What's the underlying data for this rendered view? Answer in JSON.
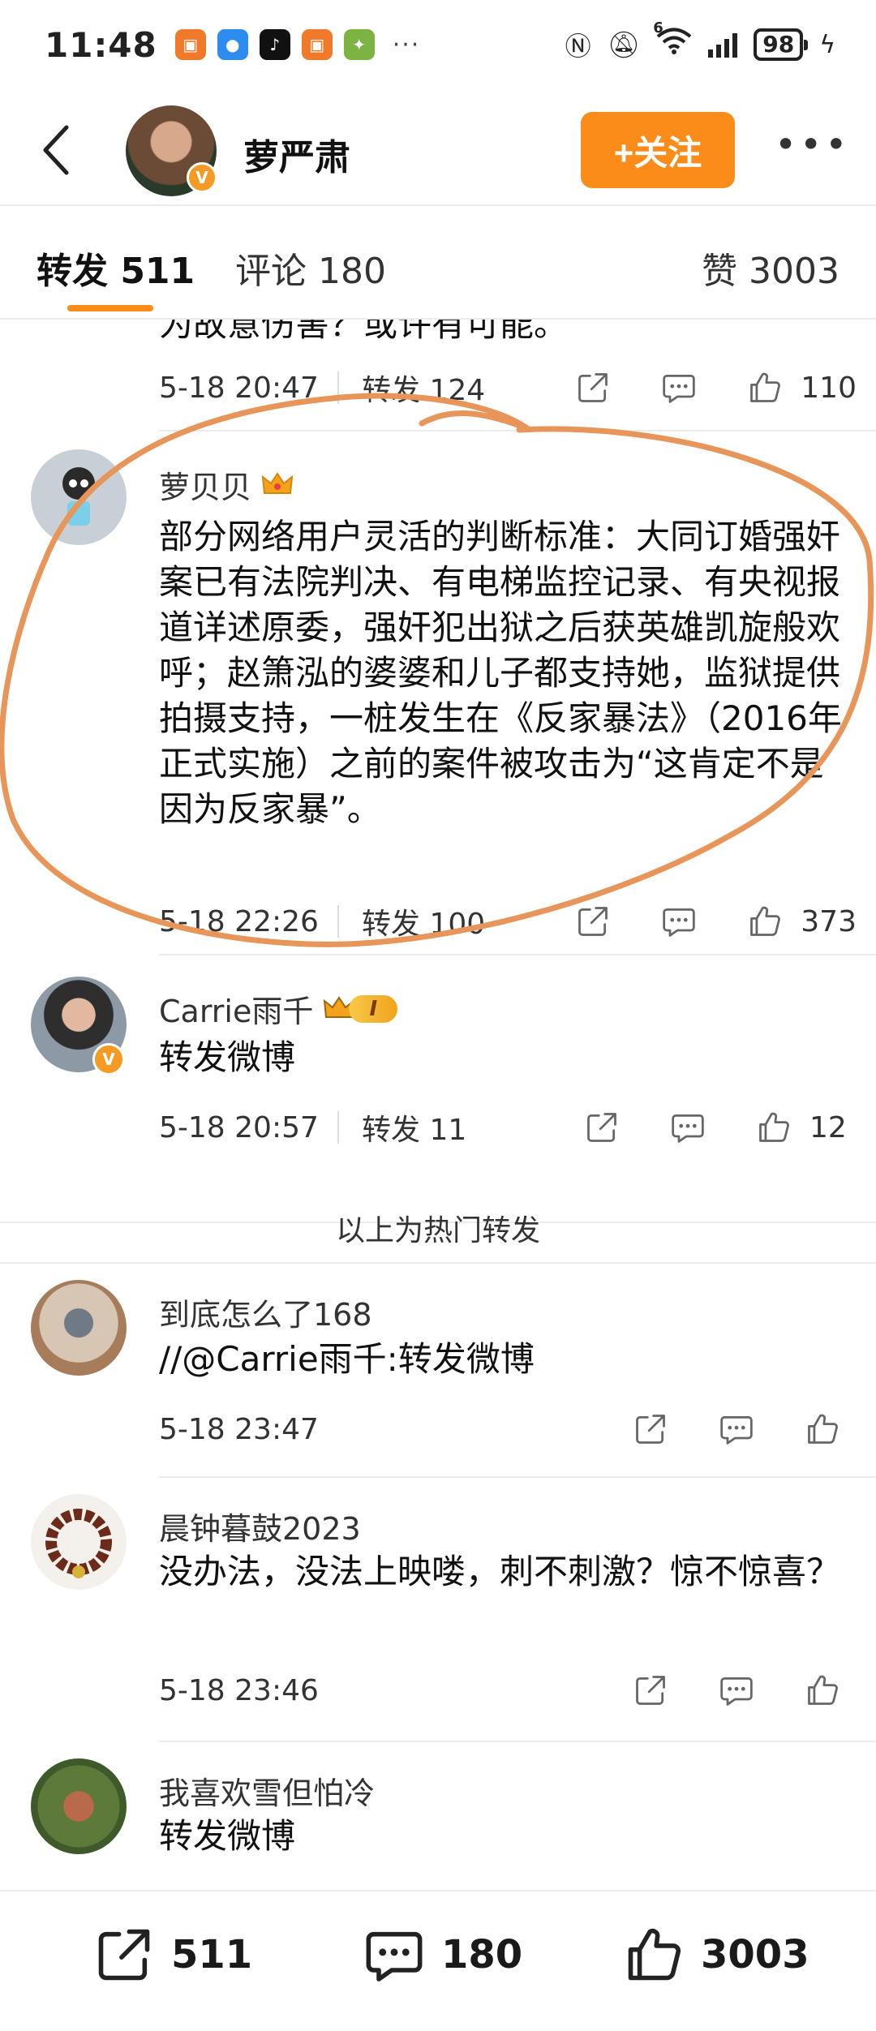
{
  "status_bar": {
    "time": "11:48",
    "battery": "98",
    "network_label": "6"
  },
  "header": {
    "profile_name": "萝严肃",
    "follow_label": "+关注",
    "more_label": "•••"
  },
  "tabs": [
    {
      "label": "转发 511"
    },
    {
      "label": "评论 180"
    },
    {
      "label": "赞 3003"
    }
  ],
  "feed": {
    "partial_item": {
      "text": "为故意伤害？或许有可能。",
      "time": "5-18 20:47",
      "forward": "转发 124",
      "likes": "110"
    },
    "hot_items": [
      {
        "username": "萝贝贝",
        "text": "部分网络用户灵活的判断标准：大同订婚强奸案已有法院判决、有电梯监控记录、有央视报道详述原委，强奸犯出狱之后获英雄凯旋般欢呼；赵箫泓的婆婆和儿子都支持她，监狱提供拍摄支持，一桩发生在《反家暴法》（2016年正式实施）之前的案件被攻击为“这肯定不是因为反家暴”。",
        "time": "5-18 22:26",
        "forward": "转发 100",
        "likes": "373"
      },
      {
        "username": "Carrie雨千",
        "vip_level": "I",
        "text": "转发微博",
        "time": "5-18 20:57",
        "forward": "转发 11",
        "likes": "12"
      }
    ],
    "hot_label": "以上为热门转发",
    "recent_items": [
      {
        "username": "到底怎么了168",
        "text": "//@Carrie雨千:转发微博",
        "time": "5-18 23:47"
      },
      {
        "username": "晨钟暮鼓2023",
        "text": "没办法，没法上映喽，刺不刺激？惊不惊喜？",
        "time": "5-18 23:46"
      },
      {
        "username": "我喜欢雪但怕冷",
        "text": "转发微博"
      }
    ]
  },
  "bottom_bar": {
    "share_count": "511",
    "comment_count": "180",
    "like_count": "3003"
  },
  "colors": {
    "accent_orange": "#fb8c1a",
    "annotation_orange": "#e8955a",
    "verified_badge": "#f59a23",
    "divider": "#ececec"
  },
  "icons": {
    "share": "share-icon",
    "comment": "comment-icon",
    "like": "thumbs-up-icon",
    "back": "chevron-left-icon"
  }
}
